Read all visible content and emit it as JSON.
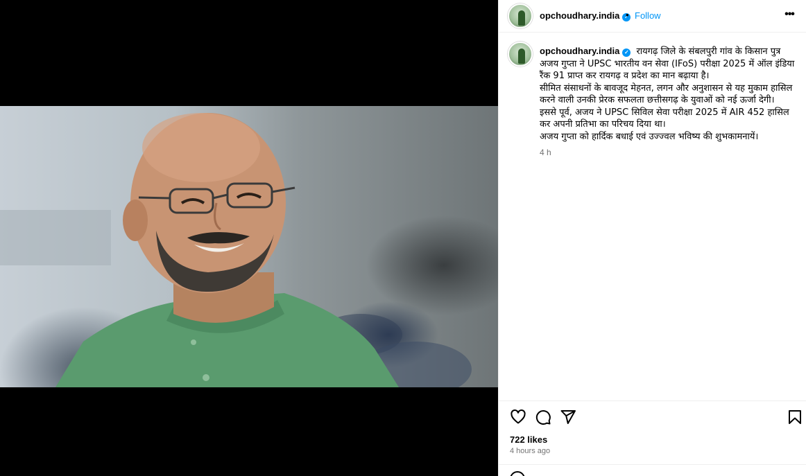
{
  "post": {
    "username": "opchoudhary.india",
    "dot": "•",
    "follow_label": "Follow",
    "more_icon": "more-horizontal-icon",
    "verified_icon": "verified-badge-icon"
  },
  "caption": {
    "username": "opchoudhary.india",
    "lines": [
      "रायगढ़ जिले के संबलपुरी गांव के किसान पुत्र अजय गुप्ता ने UPSC भारतीय वन सेवा (IFoS) परीक्षा 2025 में ऑल इंडिया रैंक 91 प्राप्त कर रायगढ़ व प्रदेश का मान बढ़ाया है।",
      "सीमित संसाधनों के बावजूद मेहनत, लगन और अनुशासन से यह मुकाम हासिल करने वाली उनकी प्रेरक सफलता छत्तीसगढ़ के युवाओं को नई ऊर्जा देगी।",
      "इससे पूर्व, अजय ने UPSC सिविल सेवा परीक्षा 2025 में AIR 452 हासिल कर अपनी प्रतिभा का परिचय दिया था।",
      "अजय गुप्ता को हार्दिक बधाई एवं उज्ज्वल भविष्य की शुभकामनायें।"
    ],
    "timestamp": "4 h"
  },
  "actions": {
    "icons": [
      "heart-icon",
      "comment-icon",
      "share-icon",
      "bookmark-icon"
    ]
  },
  "stats": {
    "likes": "722 likes",
    "posted": "4 hours ago"
  },
  "colors": {
    "accent": "#0095f6",
    "muted": "#737373",
    "border": "#efefef",
    "media_bg": "#000000"
  }
}
